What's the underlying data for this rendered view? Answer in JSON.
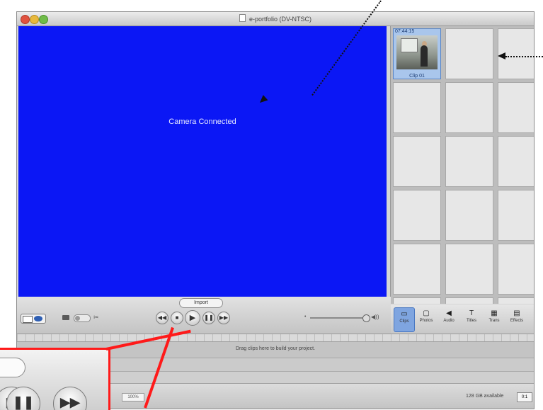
{
  "window": {
    "title": "e-portfolio (DV-NTSC)"
  },
  "viewer": {
    "status_text": "Camera Connected",
    "background_color": "#0b17f5"
  },
  "shelf": {
    "clip": {
      "timecode": "07:44:15",
      "name": "Clip 01"
    }
  },
  "controls": {
    "timecode_label": "Import",
    "buttons": [
      {
        "name": "rewind",
        "glyph": "◀◀"
      },
      {
        "name": "stop",
        "glyph": "■"
      },
      {
        "name": "play",
        "glyph": "▶"
      },
      {
        "name": "pause",
        "glyph": "❚❚"
      },
      {
        "name": "fast-forward",
        "glyph": "▶▶"
      }
    ],
    "volume_icon_min": "•",
    "volume_icon_max": "◀))"
  },
  "pane_toolbar": {
    "items": [
      {
        "label": "Clips",
        "icon": "clips-icon",
        "glyph": "▭",
        "active": true
      },
      {
        "label": "Photos",
        "icon": "photos-icon",
        "glyph": "▢",
        "active": false
      },
      {
        "label": "Audio",
        "icon": "audio-icon",
        "glyph": "◀",
        "active": false
      },
      {
        "label": "Titles",
        "icon": "titles-icon",
        "glyph": "T",
        "active": false
      },
      {
        "label": "Trans",
        "icon": "transitions-icon",
        "glyph": "▦",
        "active": false
      },
      {
        "label": "Effects",
        "icon": "effects-icon",
        "glyph": "▤",
        "active": false
      }
    ]
  },
  "timeline": {
    "hint": "Drag clips here to build your project."
  },
  "statusbar": {
    "left_field": "100%",
    "right_text": "128 GB available",
    "right_box": "0:1"
  },
  "colors": {
    "callout_border": "#ff1a1a",
    "annotation_arrow": "#111111"
  }
}
